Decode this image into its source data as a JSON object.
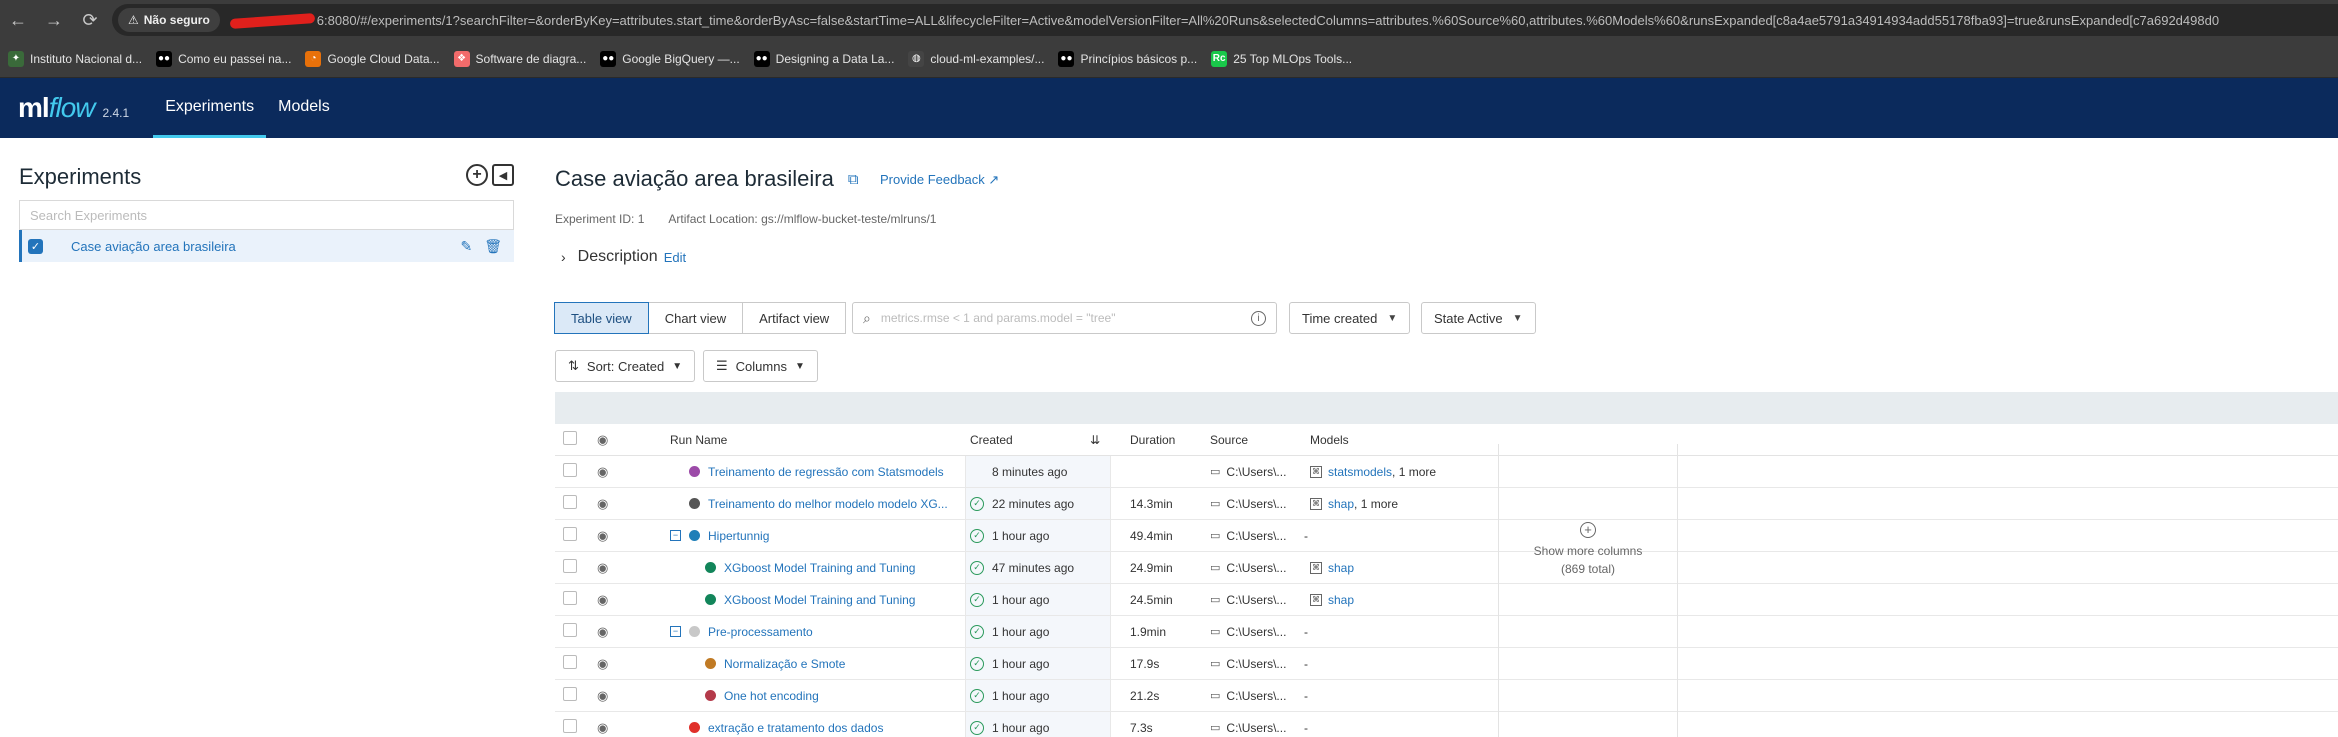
{
  "browser": {
    "security_label": "Não seguro",
    "url": "6:8080/#/experiments/1?searchFilter=&orderByKey=attributes.start_time&orderByAsc=false&startTime=ALL&lifecycleFilter=Active&modelVersionFilter=All%20Runs&selectedColumns=attributes.%60Source%60,attributes.%60Models%60&runsExpanded[c8a4ae5791a34914934add55178fba93]=true&runsExpanded[c7a692d498d0",
    "bookmarks": [
      {
        "label": "Instituto Nacional d...",
        "icon": "gov-icon",
        "color": "#3a6a3a"
      },
      {
        "label": "Como eu passei na...",
        "icon": "medium-icon",
        "color": "#000000"
      },
      {
        "label": "Google Cloud Data...",
        "icon": "gcp-icon",
        "color": "#e8710a"
      },
      {
        "label": "Software de diagra...",
        "icon": "lucid-icon",
        "color": "#f26b6b"
      },
      {
        "label": "Google BigQuery —...",
        "icon": "medium-icon",
        "color": "#000000"
      },
      {
        "label": "Designing a Data La...",
        "icon": "medium-icon",
        "color": "#000000"
      },
      {
        "label": "cloud-ml-examples/...",
        "icon": "github-icon",
        "color": "#444444"
      },
      {
        "label": "Princípios básicos p...",
        "icon": "medium-icon",
        "color": "#000000"
      },
      {
        "label": "25 Top MLOps Tools...",
        "icon": "neptune-icon",
        "color": "#19c84a"
      }
    ]
  },
  "app": {
    "logo_ml": "ml",
    "logo_flow": "flow",
    "version": "2.4.1",
    "nav": [
      {
        "label": "Experiments",
        "active": true
      },
      {
        "label": "Models",
        "active": false
      }
    ],
    "accent": "#43c9ed",
    "header_bg": "#0b2a5c"
  },
  "sidebar": {
    "title": "Experiments",
    "search_placeholder": "Search Experiments",
    "experiments": [
      {
        "name": "Case aviação area brasileira",
        "checked": true
      }
    ]
  },
  "experiment": {
    "title": "Case aviação area brasileira",
    "feedback_label": "Provide Feedback",
    "id_text": "Experiment ID: 1",
    "artifact_text": "Artifact Location: gs://mlflow-bucket-teste/mlruns/1",
    "description_label": "Description",
    "edit_label": "Edit"
  },
  "toolbar": {
    "views": [
      {
        "label": "Table view",
        "active": true
      },
      {
        "label": "Chart view",
        "active": false
      },
      {
        "label": "Artifact view",
        "active": false
      }
    ],
    "search_placeholder": "metrics.rmse < 1 and params.model = \"tree\"",
    "time_created": "Time created",
    "state": "State Active",
    "sort": "Sort: Created",
    "columns": "Columns"
  },
  "table": {
    "headers": {
      "run_name": "Run Name",
      "created": "Created",
      "duration": "Duration",
      "source": "Source",
      "models": "Models"
    },
    "rows": [
      {
        "indent": 0,
        "expand": "",
        "color": "#9c4aa8",
        "name": "Treinamento de regressão com Statsmodels",
        "status": false,
        "created": "8 minutes ago",
        "duration": "",
        "source": "C:\\Users\\...",
        "model": "statsmodels",
        "model_more": ", 1 more"
      },
      {
        "indent": 0,
        "expand": "",
        "color": "#555555",
        "name": "Treinamento do melhor modelo modelo XG...",
        "status": true,
        "created": "22 minutes ago",
        "duration": "14.3min",
        "source": "C:\\Users\\...",
        "model": "shap",
        "model_more": ", 1 more"
      },
      {
        "indent": 0,
        "expand": "⊟",
        "color": "#1f7fb8",
        "name": "Hipertunnig",
        "status": true,
        "created": "1 hour ago",
        "duration": "49.4min",
        "source": "C:\\Users\\...",
        "model": "",
        "model_more": "-"
      },
      {
        "indent": 1,
        "expand": "",
        "color": "#12855a",
        "name": "XGboost Model Training and Tuning",
        "status": true,
        "created": "47 minutes ago",
        "duration": "24.9min",
        "source": "C:\\Users\\...",
        "model": "shap",
        "model_more": ""
      },
      {
        "indent": 1,
        "expand": "",
        "color": "#12855a",
        "name": "XGboost Model Training and Tuning",
        "status": true,
        "created": "1 hour ago",
        "duration": "24.5min",
        "source": "C:\\Users\\...",
        "model": "shap",
        "model_more": ""
      },
      {
        "indent": 0,
        "expand": "⊟",
        "color": "#c8c8c8",
        "name": "Pre-processamento",
        "status": true,
        "created": "1 hour ago",
        "duration": "1.9min",
        "source": "C:\\Users\\...",
        "model": "",
        "model_more": "-"
      },
      {
        "indent": 1,
        "expand": "",
        "color": "#c07a24",
        "name": "Normalização e Smote",
        "status": true,
        "created": "1 hour ago",
        "duration": "17.9s",
        "source": "C:\\Users\\...",
        "model": "",
        "model_more": "-"
      },
      {
        "indent": 1,
        "expand": "",
        "color": "#b43a4a",
        "name": "One hot encoding",
        "status": true,
        "created": "1 hour ago",
        "duration": "21.2s",
        "source": "C:\\Users\\...",
        "model": "",
        "model_more": "-"
      },
      {
        "indent": 0,
        "expand": "",
        "color": "#e0302a",
        "name": "extração e tratamento dos dados",
        "status": true,
        "created": "1 hour ago",
        "duration": "7.3s",
        "source": "C:\\Users\\...",
        "model": "",
        "model_more": "-"
      }
    ],
    "show_more": "Show more columns",
    "show_more_total": "(869 total)"
  }
}
